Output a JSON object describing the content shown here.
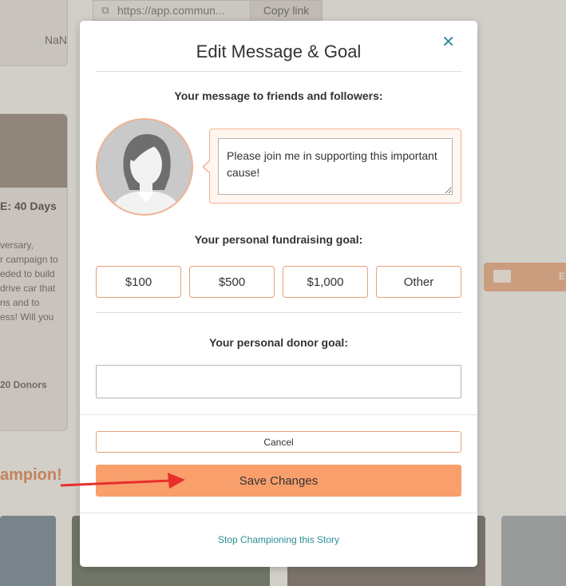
{
  "background": {
    "url_text": "https://app.commun...",
    "copy_link_label": "Copy link",
    "nan_text": "NaN",
    "days_text": "E: 40 Days",
    "story_lines": [
      "versary,",
      "r campaign to",
      "eded to build",
      "drive car that",
      "ns and to",
      "ess! Will you"
    ],
    "donors_text": "20 Donors",
    "champion_text": "ampion!",
    "email_letter": "E"
  },
  "modal": {
    "title": "Edit Message & Goal",
    "close_icon": "close-icon",
    "message_label": "Your message to friends and followers:",
    "message_value": "Please join me in supporting this important cause!",
    "fundraising_label": "Your personal fundraising goal:",
    "goal_options": [
      "$100",
      "$500",
      "$1,000",
      "Other"
    ],
    "donor_label": "Your personal donor goal:",
    "donor_value": "",
    "cancel_label": "Cancel",
    "save_label": "Save Changes",
    "stop_label": "Stop Championing this Story"
  },
  "colors": {
    "accent": "#f89f6c",
    "accent_border": "#e8a07a",
    "link": "#2b8f95",
    "annotation_arrow": "#e8302a"
  }
}
